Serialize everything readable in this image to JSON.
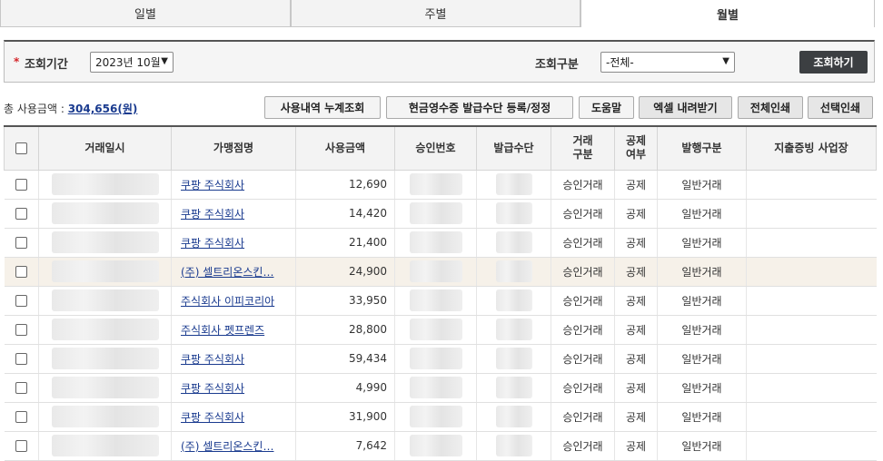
{
  "tabs": [
    {
      "label": "일별",
      "active": false
    },
    {
      "label": "주별",
      "active": false
    },
    {
      "label": "월별",
      "active": true
    }
  ],
  "search": {
    "required_mark": "*",
    "period_label": "조회기간",
    "period_value": "2023년 10월",
    "type_label": "조회구분",
    "type_value": "-전체-",
    "submit_label": "조회하기"
  },
  "summary": {
    "label": "총 사용금액 : ",
    "amount": "304,656(원)"
  },
  "buttons": {
    "cumulative": "사용내역 누계조회",
    "register": "현금영수증 발급수단 등록/정정",
    "help": "도움말",
    "excel": "엑셀 내려받기",
    "print_all": "전체인쇄",
    "print_selected": "선택인쇄"
  },
  "table": {
    "headers": [
      "거래일시",
      "가맹점명",
      "사용금액",
      "승인번호",
      "발급수단",
      "거래\n구분",
      "공제\n여부",
      "발행구분",
      "지출증빙 사업장"
    ],
    "rows": [
      {
        "merchant": "쿠팡 주식회사",
        "amount": "12,690",
        "trade_type": "승인거래",
        "deduction": "공제",
        "issue_type": "일반거래",
        "highlight": false
      },
      {
        "merchant": "쿠팡 주식회사",
        "amount": "14,420",
        "trade_type": "승인거래",
        "deduction": "공제",
        "issue_type": "일반거래",
        "highlight": false
      },
      {
        "merchant": "쿠팡 주식회사",
        "amount": "21,400",
        "trade_type": "승인거래",
        "deduction": "공제",
        "issue_type": "일반거래",
        "highlight": false
      },
      {
        "merchant": "(주) 셀트리온스킨…",
        "amount": "24,900",
        "trade_type": "승인거래",
        "deduction": "공제",
        "issue_type": "일반거래",
        "highlight": true
      },
      {
        "merchant": "주식회사 이피코리아",
        "amount": "33,950",
        "trade_type": "승인거래",
        "deduction": "공제",
        "issue_type": "일반거래",
        "highlight": false
      },
      {
        "merchant": "주식회사 펫프렌즈",
        "amount": "28,800",
        "trade_type": "승인거래",
        "deduction": "공제",
        "issue_type": "일반거래",
        "highlight": false
      },
      {
        "merchant": "쿠팡 주식회사",
        "amount": "59,434",
        "trade_type": "승인거래",
        "deduction": "공제",
        "issue_type": "일반거래",
        "highlight": false
      },
      {
        "merchant": "쿠팡 주식회사",
        "amount": "4,990",
        "trade_type": "승인거래",
        "deduction": "공제",
        "issue_type": "일반거래",
        "highlight": false
      },
      {
        "merchant": "쿠팡 주식회사",
        "amount": "31,900",
        "trade_type": "승인거래",
        "deduction": "공제",
        "issue_type": "일반거래",
        "highlight": false
      },
      {
        "merchant": "(주) 셀트리온스킨…",
        "amount": "7,642",
        "trade_type": "승인거래",
        "deduction": "공제",
        "issue_type": "일반거래",
        "highlight": false
      }
    ]
  },
  "colors": {
    "link": "#1a3b8f",
    "submit_button": "#3c3f42",
    "required": "#d4252a",
    "highlight_row": "#f6f1e9"
  }
}
